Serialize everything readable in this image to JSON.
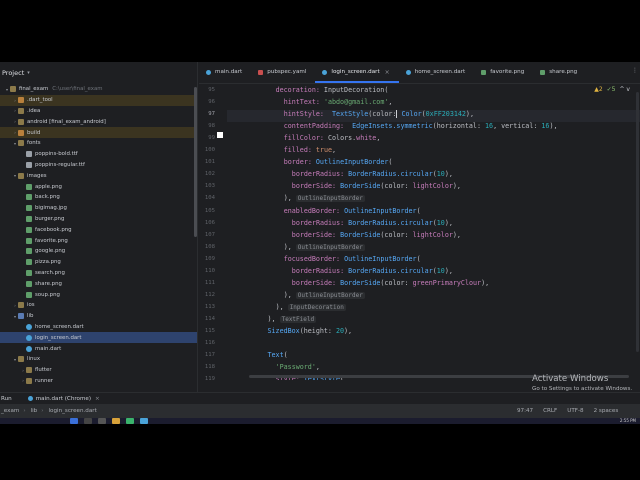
{
  "project_panel": {
    "title": "Project",
    "tree": [
      {
        "label": "final_exam",
        "extra": "C:\\user\\final_exam",
        "depth": 0,
        "arrow": "▾",
        "icon": "folder",
        "selected": false,
        "highlighted": false
      },
      {
        "label": ".dart_tool",
        "extra": "",
        "depth": 1,
        "arrow": "›",
        "icon": "folder-orange",
        "selected": false,
        "highlighted": true
      },
      {
        "label": ".idea",
        "extra": "",
        "depth": 1,
        "arrow": "›",
        "icon": "folder",
        "selected": false,
        "highlighted": false
      },
      {
        "label": "android [final_exam_android]",
        "extra": "",
        "depth": 1,
        "arrow": "›",
        "icon": "folder",
        "selected": false,
        "highlighted": false
      },
      {
        "label": "build",
        "extra": "",
        "depth": 1,
        "arrow": "›",
        "icon": "folder-orange",
        "selected": false,
        "highlighted": true
      },
      {
        "label": "fonts",
        "extra": "",
        "depth": 1,
        "arrow": "▾",
        "icon": "folder",
        "selected": false,
        "highlighted": false
      },
      {
        "label": "poppins-bold.ttf",
        "extra": "",
        "depth": 2,
        "arrow": "",
        "icon": "file",
        "selected": false,
        "highlighted": false
      },
      {
        "label": "poppins-regular.ttf",
        "extra": "",
        "depth": 2,
        "arrow": "",
        "icon": "file",
        "selected": false,
        "highlighted": false
      },
      {
        "label": "images",
        "extra": "",
        "depth": 1,
        "arrow": "▾",
        "icon": "folder",
        "selected": false,
        "highlighted": false
      },
      {
        "label": "apple.png",
        "extra": "",
        "depth": 2,
        "arrow": "",
        "icon": "img",
        "selected": false,
        "highlighted": false
      },
      {
        "label": "back.png",
        "extra": "",
        "depth": 2,
        "arrow": "",
        "icon": "img",
        "selected": false,
        "highlighted": false
      },
      {
        "label": "bigimag.jpg",
        "extra": "",
        "depth": 2,
        "arrow": "",
        "icon": "img",
        "selected": false,
        "highlighted": false
      },
      {
        "label": "burger.png",
        "extra": "",
        "depth": 2,
        "arrow": "",
        "icon": "img",
        "selected": false,
        "highlighted": false
      },
      {
        "label": "facebook.png",
        "extra": "",
        "depth": 2,
        "arrow": "",
        "icon": "img",
        "selected": false,
        "highlighted": false
      },
      {
        "label": "favorite.png",
        "extra": "",
        "depth": 2,
        "arrow": "",
        "icon": "img",
        "selected": false,
        "highlighted": false
      },
      {
        "label": "google.png",
        "extra": "",
        "depth": 2,
        "arrow": "",
        "icon": "img",
        "selected": false,
        "highlighted": false
      },
      {
        "label": "pizza.png",
        "extra": "",
        "depth": 2,
        "arrow": "",
        "icon": "img",
        "selected": false,
        "highlighted": false
      },
      {
        "label": "search.png",
        "extra": "",
        "depth": 2,
        "arrow": "",
        "icon": "img",
        "selected": false,
        "highlighted": false
      },
      {
        "label": "share.png",
        "extra": "",
        "depth": 2,
        "arrow": "",
        "icon": "img",
        "selected": false,
        "highlighted": false
      },
      {
        "label": "soup.png",
        "extra": "",
        "depth": 2,
        "arrow": "",
        "icon": "img",
        "selected": false,
        "highlighted": false
      },
      {
        "label": "ios",
        "extra": "",
        "depth": 1,
        "arrow": "›",
        "icon": "folder",
        "selected": false,
        "highlighted": false
      },
      {
        "label": "lib",
        "extra": "",
        "depth": 1,
        "arrow": "▾",
        "icon": "folder-blue",
        "selected": false,
        "highlighted": false
      },
      {
        "label": "home_screen.dart",
        "extra": "",
        "depth": 2,
        "arrow": "",
        "icon": "dart",
        "selected": false,
        "highlighted": false
      },
      {
        "label": "login_screen.dart",
        "extra": "",
        "depth": 2,
        "arrow": "",
        "icon": "dart",
        "selected": true,
        "highlighted": false
      },
      {
        "label": "main.dart",
        "extra": "",
        "depth": 2,
        "arrow": "",
        "icon": "dart",
        "selected": false,
        "highlighted": false
      },
      {
        "label": "linux",
        "extra": "",
        "depth": 1,
        "arrow": "▾",
        "icon": "folder",
        "selected": false,
        "highlighted": false
      },
      {
        "label": "flutter",
        "extra": "",
        "depth": 2,
        "arrow": "›",
        "icon": "folder",
        "selected": false,
        "highlighted": false
      },
      {
        "label": "runner",
        "extra": "",
        "depth": 2,
        "arrow": "›",
        "icon": "folder",
        "selected": false,
        "highlighted": false
      }
    ]
  },
  "editor": {
    "tabs": [
      {
        "label": "main.dart",
        "icon": "dart",
        "active": false
      },
      {
        "label": "pubspec.yaml",
        "icon": "yaml",
        "active": false
      },
      {
        "label": "login_screen.dart",
        "icon": "dart",
        "active": true
      },
      {
        "label": "home_screen.dart",
        "icon": "dart",
        "active": false
      },
      {
        "label": "favorite.png",
        "icon": "png",
        "active": false
      },
      {
        "label": "share.png",
        "icon": "png",
        "active": false
      }
    ],
    "tabs_overflow": "⋮",
    "inspection": {
      "warnings": "▲2",
      "ok": "✓5",
      "nav": "^ v"
    },
    "gutter_numbers": [
      "95",
      "96",
      "97",
      "98",
      "99",
      "100",
      "101",
      "102",
      "103",
      "104",
      "105",
      "106",
      "107",
      "108",
      "109",
      "110",
      "111",
      "112",
      "113",
      "114",
      "115",
      "116",
      "117",
      "118",
      "119"
    ],
    "current_line": "97",
    "code_lines": [
      {
        "indent": 12,
        "parts": [
          [
            "prop",
            "decoration: "
          ],
          [
            "cls",
            "InputDecoration("
          ]
        ]
      },
      {
        "indent": 14,
        "parts": [
          [
            "prop",
            "hintText: "
          ],
          [
            "str",
            "'abdo@gmail.com'"
          ],
          [
            "cls",
            ","
          ]
        ]
      },
      {
        "indent": 14,
        "parts": [
          [
            "prop",
            "hintStyle:  "
          ],
          [
            "fn",
            "TextStyle"
          ],
          [
            "cls",
            "(color:"
          ],
          [
            "cursor",
            ""
          ],
          [
            "cls",
            " "
          ],
          [
            "fn",
            "Color"
          ],
          [
            "cls",
            "("
          ],
          [
            "num",
            "0xFF203142"
          ],
          [
            "cls",
            "),"
          ]
        ]
      },
      {
        "indent": 14,
        "parts": [
          [
            "prop",
            "contentPadding:  "
          ],
          [
            "fn",
            "EdgeInsets.symmetric"
          ],
          [
            "cls",
            "(horizontal: "
          ],
          [
            "num",
            "16"
          ],
          [
            "cls",
            ", vertical: "
          ],
          [
            "num",
            "16"
          ],
          [
            "cls",
            "),"
          ]
        ]
      },
      {
        "indent": 14,
        "parts": [
          [
            "prop",
            "fillColor: "
          ],
          [
            "cls",
            "Colors."
          ],
          [
            "prop",
            "white"
          ],
          [
            "cls",
            ","
          ]
        ]
      },
      {
        "indent": 14,
        "parts": [
          [
            "prop",
            "filled: "
          ],
          [
            "k",
            "true"
          ],
          [
            "cls",
            ","
          ]
        ]
      },
      {
        "indent": 14,
        "parts": [
          [
            "prop",
            "border: "
          ],
          [
            "fn",
            "OutlineInputBorder"
          ],
          [
            "cls",
            "("
          ]
        ]
      },
      {
        "indent": 16,
        "parts": [
          [
            "prop",
            "borderRadius: "
          ],
          [
            "fn",
            "BorderRadius.circular"
          ],
          [
            "cls",
            "("
          ],
          [
            "num",
            "10"
          ],
          [
            "cls",
            "),"
          ]
        ]
      },
      {
        "indent": 16,
        "parts": [
          [
            "prop",
            "borderSide: "
          ],
          [
            "fn",
            "BorderSide"
          ],
          [
            "cls",
            "(color: "
          ],
          [
            "prop",
            "lightColor"
          ],
          [
            "cls",
            "),"
          ]
        ]
      },
      {
        "indent": 14,
        "parts": [
          [
            "cls",
            "), "
          ],
          [
            "hint",
            "OutlineInputBorder"
          ]
        ]
      },
      {
        "indent": 14,
        "parts": [
          [
            "prop",
            "enabledBorder: "
          ],
          [
            "fn",
            "OutlineInputBorder"
          ],
          [
            "cls",
            "("
          ]
        ]
      },
      {
        "indent": 16,
        "parts": [
          [
            "prop",
            "borderRadius: "
          ],
          [
            "fn",
            "BorderRadius.circular"
          ],
          [
            "cls",
            "("
          ],
          [
            "num",
            "10"
          ],
          [
            "cls",
            "),"
          ]
        ]
      },
      {
        "indent": 16,
        "parts": [
          [
            "prop",
            "borderSide: "
          ],
          [
            "fn",
            "BorderSide"
          ],
          [
            "cls",
            "(color: "
          ],
          [
            "prop",
            "lightColor"
          ],
          [
            "cls",
            "),"
          ]
        ]
      },
      {
        "indent": 14,
        "parts": [
          [
            "cls",
            "), "
          ],
          [
            "hint",
            "OutlineInputBorder"
          ]
        ]
      },
      {
        "indent": 14,
        "parts": [
          [
            "prop",
            "focusedBorder: "
          ],
          [
            "fn",
            "OutlineInputBorder"
          ],
          [
            "cls",
            "("
          ]
        ]
      },
      {
        "indent": 16,
        "parts": [
          [
            "prop",
            "borderRadius: "
          ],
          [
            "fn",
            "BorderRadius.circular"
          ],
          [
            "cls",
            "("
          ],
          [
            "num",
            "10"
          ],
          [
            "cls",
            "),"
          ]
        ]
      },
      {
        "indent": 16,
        "parts": [
          [
            "prop",
            "borderSide: "
          ],
          [
            "fn",
            "BorderSide"
          ],
          [
            "cls",
            "(color: "
          ],
          [
            "prop",
            "greenPrimaryClour"
          ],
          [
            "cls",
            "),"
          ]
        ]
      },
      {
        "indent": 14,
        "parts": [
          [
            "cls",
            "), "
          ],
          [
            "hint",
            "OutlineInputBorder"
          ]
        ]
      },
      {
        "indent": 12,
        "parts": [
          [
            "cls",
            "), "
          ],
          [
            "hint",
            "InputDecoration"
          ]
        ]
      },
      {
        "indent": 10,
        "parts": [
          [
            "cls",
            "), "
          ],
          [
            "hint",
            "TextField"
          ]
        ]
      },
      {
        "indent": 10,
        "parts": [
          [
            "fn",
            "SizedBox"
          ],
          [
            "cls",
            "(height: "
          ],
          [
            "num",
            "20"
          ],
          [
            "cls",
            "),"
          ]
        ]
      },
      {
        "indent": 0,
        "parts": []
      },
      {
        "indent": 10,
        "parts": [
          [
            "fn",
            "Text"
          ],
          [
            "cls",
            "("
          ]
        ]
      },
      {
        "indent": 12,
        "parts": [
          [
            "str",
            "'Password'"
          ],
          [
            "cls",
            ","
          ]
        ]
      },
      {
        "indent": 12,
        "parts": [
          [
            "prop",
            "style: "
          ],
          [
            "fn",
            "TextStyle"
          ],
          [
            "cls",
            "("
          ]
        ]
      }
    ]
  },
  "run_bar": {
    "label": "Run",
    "config": "main.dart (Chrome)"
  },
  "status_bar": {
    "breadcrumbs": [
      "_exam",
      "lib",
      "login_screen.dart"
    ],
    "position": "97:47",
    "line_sep": "CRLF",
    "encoding": "UTF-8",
    "indent": "2 spaces"
  },
  "watermark": {
    "title": "Activate Windows",
    "subtitle": "Go to Settings to activate Windows."
  },
  "taskbar": {
    "clock": "2:55 PM"
  },
  "colors": {
    "accent": "#3574f0",
    "selection": "#2e436e",
    "editor_bg": "#1e1f22"
  }
}
